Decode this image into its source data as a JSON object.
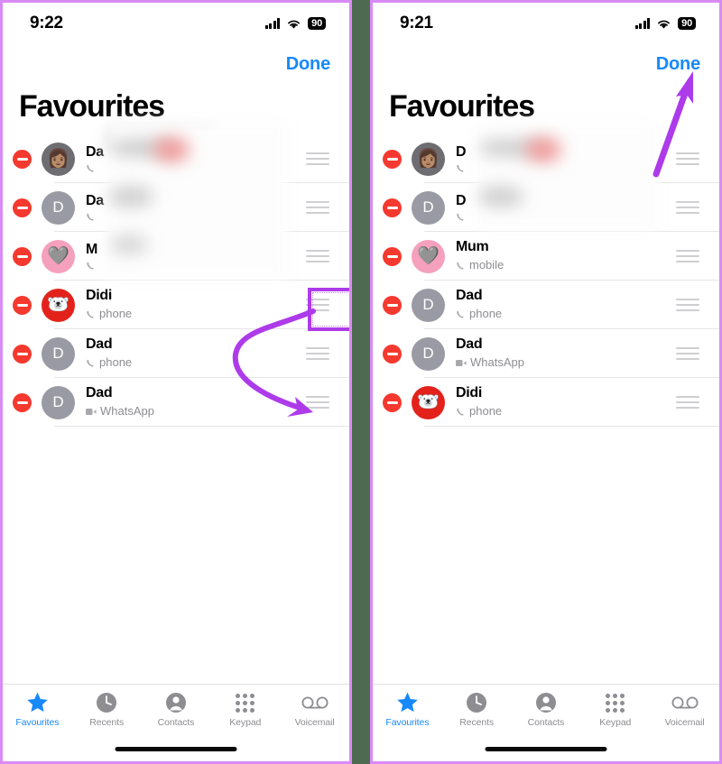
{
  "meta": {
    "accent_purple": "#ad3bea",
    "panel_border": "#d98bf5",
    "backdrop": "#4e6b52",
    "ios_blue": "#1789fc",
    "destructive_red": "#f5392f"
  },
  "panels": [
    {
      "id": "left",
      "status": {
        "time": "9:22",
        "signal_icon": "cellular-signal-icon",
        "wifi_icon": "wifi-icon",
        "battery_icon": "battery-icon",
        "battery_level": "90"
      },
      "nav": {
        "done_label": "Done"
      },
      "title": "Favourites",
      "rows": [
        {
          "name": "Da",
          "sub": "",
          "sub_icon": "phone-icon",
          "avatar": "memoji",
          "avatar_letter": "",
          "redacted": true,
          "handle_icon": "drag-handle-icon",
          "remove_icon": "remove-minus-icon"
        },
        {
          "name": "Da",
          "sub": "",
          "sub_icon": "phone-icon",
          "avatar": "letter",
          "avatar_letter": "D",
          "redacted": true,
          "handle_icon": "drag-handle-icon",
          "remove_icon": "remove-minus-icon"
        },
        {
          "name": "M",
          "sub": "",
          "sub_icon": "phone-icon",
          "avatar": "pink",
          "avatar_letter": "",
          "redacted": true,
          "handle_icon": "drag-handle-icon",
          "remove_icon": "remove-minus-icon"
        },
        {
          "name": "Didi",
          "sub": "phone",
          "sub_icon": "phone-icon",
          "avatar": "red",
          "avatar_letter": "",
          "redacted": false,
          "handle_icon": "drag-handle-icon",
          "remove_icon": "remove-minus-icon"
        },
        {
          "name": "Dad",
          "sub": "phone",
          "sub_icon": "phone-icon",
          "avatar": "letter",
          "avatar_letter": "D",
          "redacted": false,
          "handle_icon": "drag-handle-icon",
          "remove_icon": "remove-minus-icon"
        },
        {
          "name": "Dad",
          "sub": "WhatsApp",
          "sub_icon": "video-icon",
          "avatar": "letter",
          "avatar_letter": "D",
          "redacted": false,
          "handle_icon": "drag-handle-icon",
          "remove_icon": "remove-minus-icon"
        }
      ],
      "tabs": [
        {
          "label": "Favourites",
          "icon": "star-icon",
          "active": true
        },
        {
          "label": "Recents",
          "icon": "clock-icon",
          "active": false
        },
        {
          "label": "Contacts",
          "icon": "person-icon",
          "active": false
        },
        {
          "label": "Keypad",
          "icon": "keypad-icon",
          "active": false
        },
        {
          "label": "Voicemail",
          "icon": "voicemail-icon",
          "active": false
        }
      ],
      "annotations": {
        "highlight_target": "drag-handle of row 4 (Didi / phone)",
        "arrow": "curved-arrow-drag-down"
      }
    },
    {
      "id": "right",
      "status": {
        "time": "9:21",
        "signal_icon": "cellular-signal-icon",
        "wifi_icon": "wifi-icon",
        "battery_icon": "battery-icon",
        "battery_level": "90"
      },
      "nav": {
        "done_label": "Done"
      },
      "title": "Favourites",
      "rows": [
        {
          "name": "D",
          "sub": "",
          "sub_icon": "phone-icon",
          "avatar": "memoji",
          "avatar_letter": "",
          "redacted": true,
          "handle_icon": "drag-handle-icon",
          "remove_icon": "remove-minus-icon"
        },
        {
          "name": "D",
          "sub": "",
          "sub_icon": "phone-icon",
          "avatar": "letter",
          "avatar_letter": "D",
          "redacted": true,
          "handle_icon": "drag-handle-icon",
          "remove_icon": "remove-minus-icon"
        },
        {
          "name": "Mum",
          "sub": "mobile",
          "sub_icon": "phone-icon",
          "avatar": "pink",
          "avatar_letter": "",
          "redacted": false,
          "handle_icon": "drag-handle-icon",
          "remove_icon": "remove-minus-icon"
        },
        {
          "name": "Dad",
          "sub": "phone",
          "sub_icon": "phone-icon",
          "avatar": "letter",
          "avatar_letter": "D",
          "redacted": false,
          "handle_icon": "drag-handle-icon",
          "remove_icon": "remove-minus-icon"
        },
        {
          "name": "Dad",
          "sub": "WhatsApp",
          "sub_icon": "video-icon",
          "avatar": "letter",
          "avatar_letter": "D",
          "redacted": false,
          "handle_icon": "drag-handle-icon",
          "remove_icon": "remove-minus-icon"
        },
        {
          "name": "Didi",
          "sub": "phone",
          "sub_icon": "phone-icon",
          "avatar": "red",
          "avatar_letter": "",
          "redacted": false,
          "handle_icon": "drag-handle-icon",
          "remove_icon": "remove-minus-icon"
        }
      ],
      "tabs": [
        {
          "label": "Favourites",
          "icon": "star-icon",
          "active": true
        },
        {
          "label": "Recents",
          "icon": "clock-icon",
          "active": false
        },
        {
          "label": "Contacts",
          "icon": "person-icon",
          "active": false
        },
        {
          "label": "Keypad",
          "icon": "keypad-icon",
          "active": false
        },
        {
          "label": "Voicemail",
          "icon": "voicemail-icon",
          "active": false
        }
      ],
      "annotations": {
        "arrow": "straight-arrow-to-done"
      }
    }
  ]
}
